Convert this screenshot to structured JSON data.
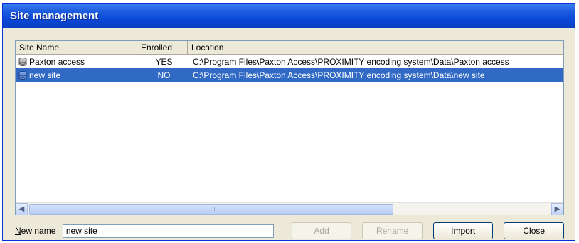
{
  "window": {
    "title": "Site management"
  },
  "list": {
    "columns": [
      "Site Name",
      "Enrolled",
      "Location"
    ],
    "rows": [
      {
        "name": "Paxton access",
        "enrolled": "YES",
        "location": "C:\\Program Files\\Paxton Access\\PROXIMITY encoding system\\Data\\Paxton access",
        "selected": false
      },
      {
        "name": "new site",
        "enrolled": "NO",
        "location": "C:\\Program Files\\Paxton Access\\PROXIMITY encoding system\\Data\\new site",
        "selected": true
      }
    ],
    "row_icon": "database-icon"
  },
  "bottom": {
    "new_name_label": "New name",
    "new_name_value": "new site",
    "add_label": "Add",
    "rename_label": "Rename",
    "import_label": "Import",
    "close_label": "Close"
  },
  "colors": {
    "selection": "#316ac5",
    "title_bar": "#0a48d6",
    "window_bg": "#ece9d8"
  }
}
